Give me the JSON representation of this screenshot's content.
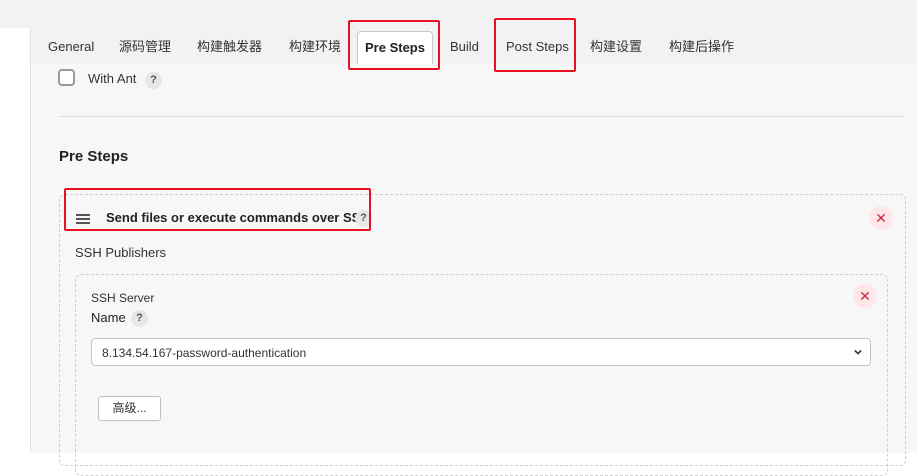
{
  "tabs": [
    {
      "label": "General"
    },
    {
      "label": "源码管理"
    },
    {
      "label": "构建触发器"
    },
    {
      "label": "构建环境"
    },
    {
      "label": "Pre Steps"
    },
    {
      "label": "Build"
    },
    {
      "label": "Post Steps"
    },
    {
      "label": "构建设置"
    },
    {
      "label": "构建后操作"
    }
  ],
  "active_tab": "Pre Steps",
  "with_ant": {
    "label": "With Ant",
    "checked": false
  },
  "help_glyph": "?",
  "section": {
    "title": "Pre Steps"
  },
  "step": {
    "title": "Send files or execute commands over SSH",
    "close_glyph": "✕"
  },
  "publishers": {
    "label": "SSH Publishers"
  },
  "server": {
    "label": "SSH Server",
    "name_label": "Name",
    "name_value": "8.134.54.167-password-authentication",
    "advanced_label": "高级...",
    "close_glyph": "✕"
  },
  "colors": {
    "highlight": "#e81123",
    "remove": "#d1253d",
    "remove_bg": "#fde7ea"
  }
}
